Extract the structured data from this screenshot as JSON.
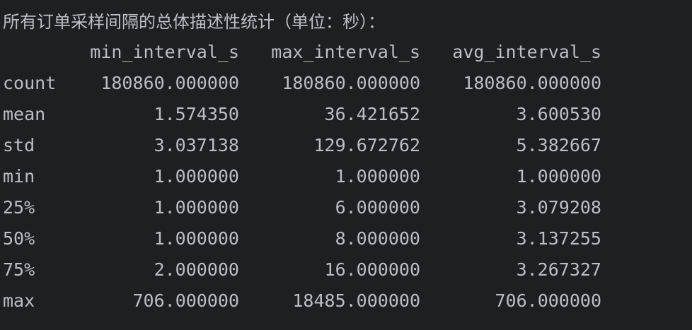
{
  "heading": "所有订单采样间隔的总体描述性统计（单位：秒）：",
  "columns": [
    "min_interval_s",
    "max_interval_s",
    "avg_interval_s"
  ],
  "rows": [
    {
      "label": "count",
      "values": [
        "180860.000000",
        "180860.000000",
        "180860.000000"
      ]
    },
    {
      "label": "mean",
      "values": [
        "1.574350",
        "36.421652",
        "3.600530"
      ]
    },
    {
      "label": "std",
      "values": [
        "3.037138",
        "129.672762",
        "5.382667"
      ]
    },
    {
      "label": "min",
      "values": [
        "1.000000",
        "1.000000",
        "1.000000"
      ]
    },
    {
      "label": "25%",
      "values": [
        "1.000000",
        "6.000000",
        "3.079208"
      ]
    },
    {
      "label": "50%",
      "values": [
        "1.000000",
        "8.000000",
        "3.137255"
      ]
    },
    {
      "label": "75%",
      "values": [
        "2.000000",
        "16.000000",
        "3.267327"
      ]
    },
    {
      "label": "max",
      "values": [
        "706.000000",
        "18485.000000",
        "706.000000"
      ]
    }
  ]
}
